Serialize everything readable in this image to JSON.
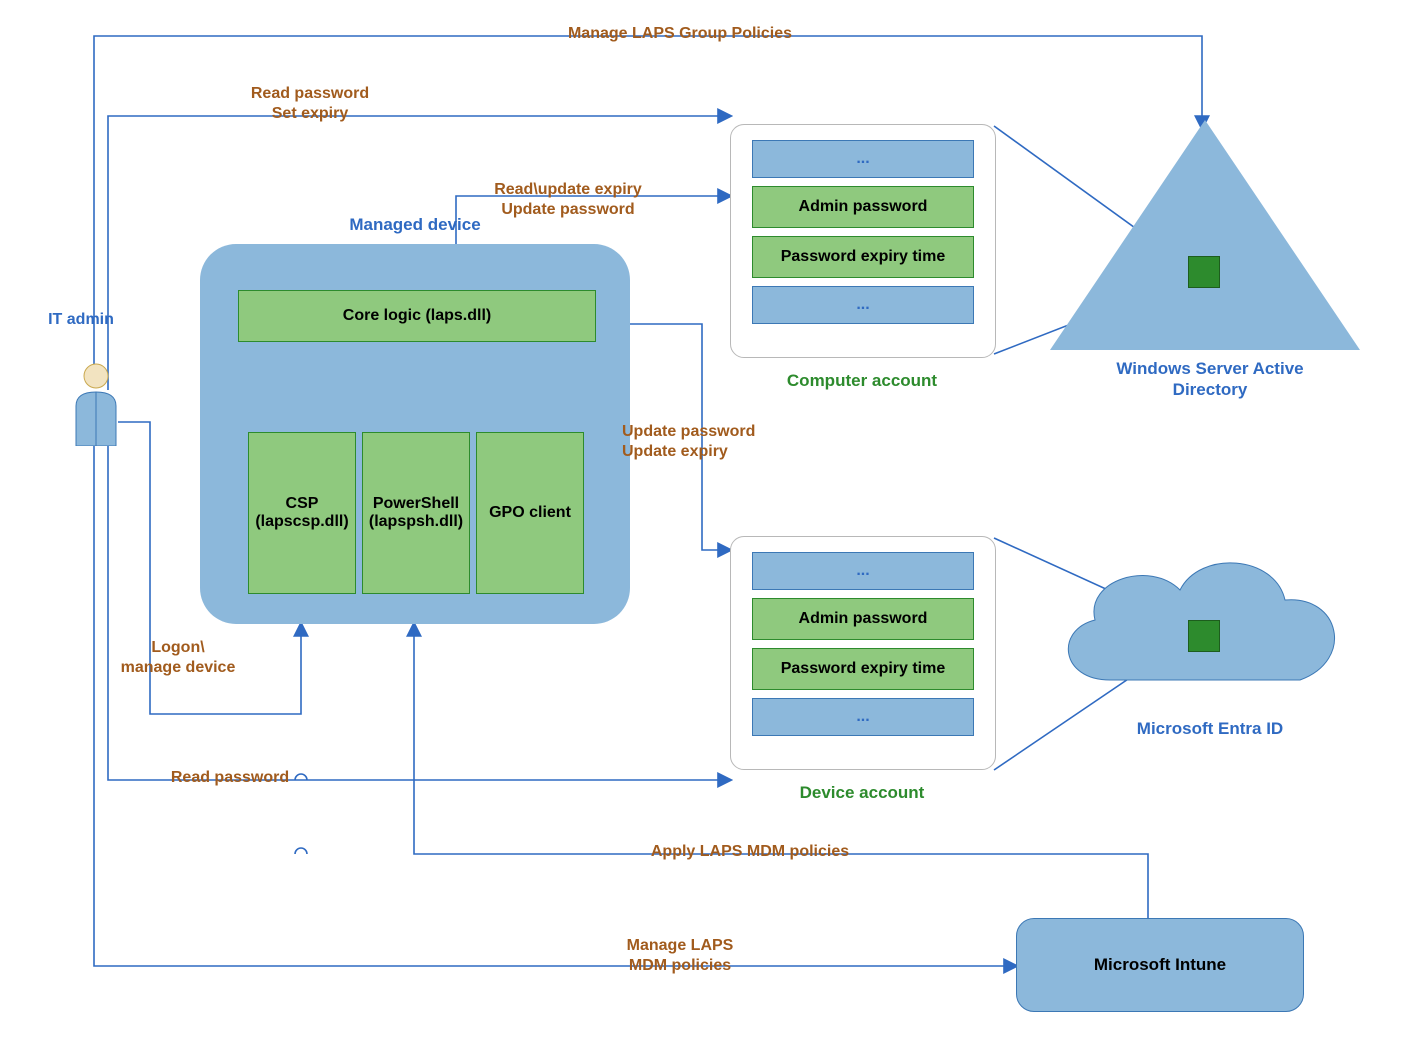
{
  "it_admin": {
    "label": "IT\nadmin"
  },
  "managed_device": {
    "title": "Managed device",
    "core": "Core logic (laps.dll)",
    "csp": "CSP\n(lapscsp.dll)",
    "ps": "PowerShell\n(lapspsh.dll)",
    "gpo": "GPO client"
  },
  "computer_account": {
    "title": "Computer account",
    "rows": [
      "...",
      "Admin password",
      "Password expiry time",
      "..."
    ]
  },
  "device_account": {
    "title": "Device account",
    "rows": [
      "...",
      "Admin password",
      "Password expiry time",
      "..."
    ]
  },
  "ad": {
    "title": "Windows Server Active\nDirectory"
  },
  "entra": {
    "title": "Microsoft Entra ID"
  },
  "intune": {
    "title": "Microsoft Intune"
  },
  "edges": {
    "manage_group_policies": "Manage LAPS Group Policies",
    "read_set_expiry": "Read password\nSet expiry",
    "read_update_expiry": "Read\\update expiry\nUpdate password",
    "update_password_expiry": "Update password\nUpdate expiry",
    "logon_manage": "Logon\\\nmanage device",
    "read_password": "Read password",
    "apply_mdm": "Apply LAPS MDM policies",
    "manage_mdm": "Manage LAPS\nMDM policies"
  },
  "colors": {
    "blue_fill": "#8CB8DB",
    "blue_line": "#2F6AC2",
    "green_fill": "#8FC97E",
    "green_line": "#2D8B2D",
    "brown": "#A15B1D"
  }
}
